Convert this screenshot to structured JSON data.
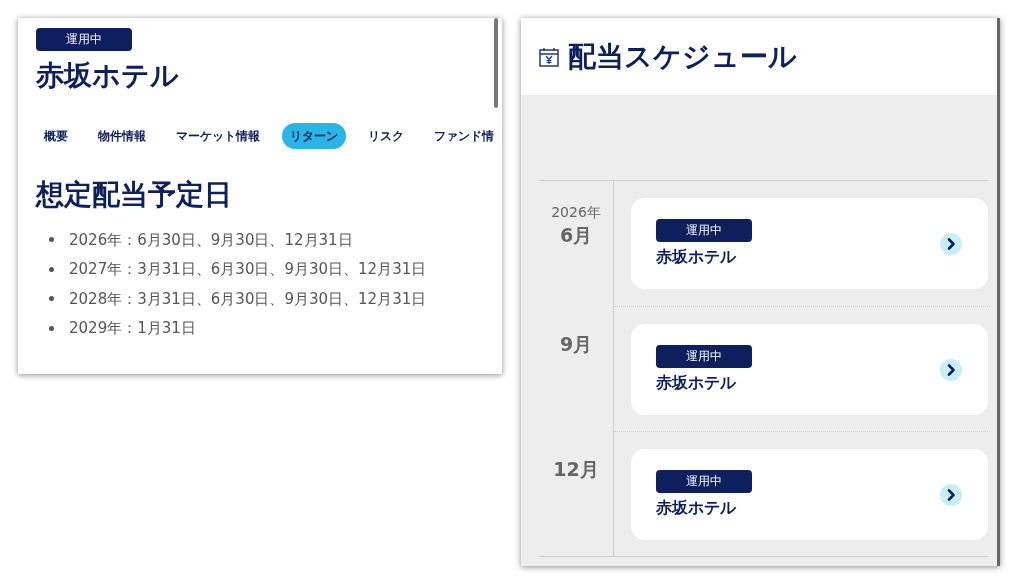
{
  "left_panel": {
    "status_badge": "運用中",
    "title": "赤坂ホテル",
    "tabs": [
      {
        "label": "概要",
        "selected": false
      },
      {
        "label": "物件情報",
        "selected": false
      },
      {
        "label": "マーケット情報",
        "selected": false
      },
      {
        "label": "リターン",
        "selected": true
      },
      {
        "label": "リスク",
        "selected": false
      },
      {
        "label": "ファンド情",
        "selected": false
      }
    ],
    "section_heading": "想定配当予定日",
    "dates": [
      "2026年：6月30日、9月30日、12月31日",
      "2027年：3月31日、6月30日、9月30日、12月31日",
      "2028年：3月31日、6月30日、9月30日、12月31日",
      "2029年：1月31日"
    ]
  },
  "right_panel": {
    "title": "配当スケジュール",
    "schedule": [
      {
        "year": "2026年",
        "month": "6月",
        "status_badge": "運用中",
        "name": "赤坂ホテル"
      },
      {
        "month": "9月",
        "status_badge": "運用中",
        "name": "赤坂ホテル"
      },
      {
        "month": "12月",
        "status_badge": "運用中",
        "name": "赤坂ホテル"
      }
    ]
  }
}
